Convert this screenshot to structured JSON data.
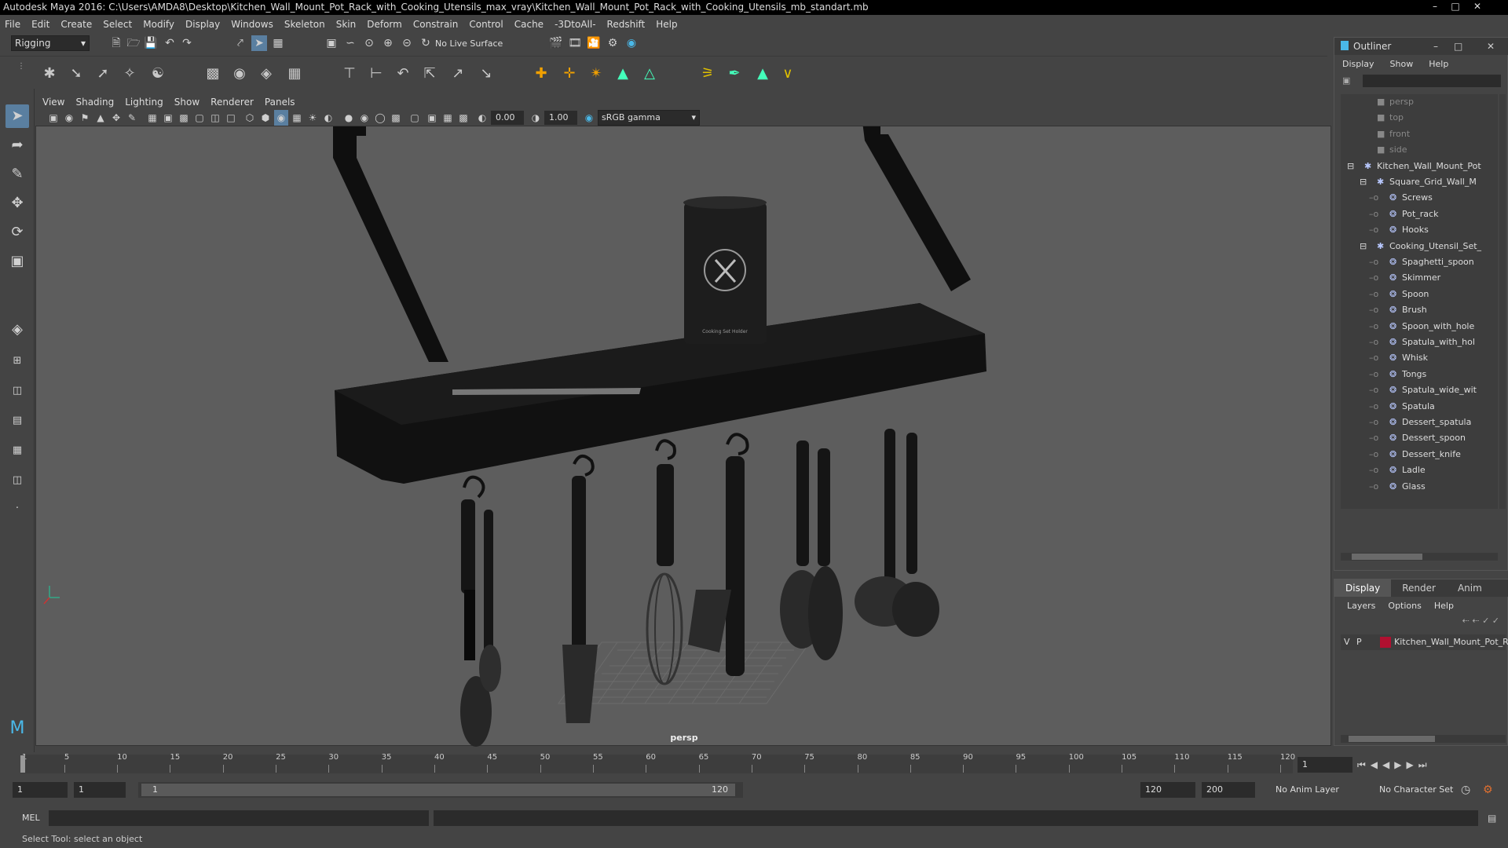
{
  "window": {
    "title": "Autodesk Maya 2016: C:\\Users\\AMDA8\\Desktop\\Kitchen_Wall_Mount_Pot_Rack_with_Cooking_Utensils_max_vray\\Kitchen_Wall_Mount_Pot_Rack_with_Cooking_Utensils_mb_standart.mb"
  },
  "menubar": [
    "File",
    "Edit",
    "Create",
    "Select",
    "Modify",
    "Display",
    "Windows",
    "Skeleton",
    "Skin",
    "Deform",
    "Constrain",
    "Control",
    "Cache",
    "-3DtoAll-",
    "Redshift",
    "Help"
  ],
  "statusline": {
    "mode": "Rigging",
    "live_surface": "No Live Surface"
  },
  "panel": {
    "menus": [
      "View",
      "Shading",
      "Lighting",
      "Show",
      "Renderer",
      "Panels"
    ],
    "exposure": "0.00",
    "gamma": "1.00",
    "colorspace": "sRGB gamma",
    "camera_label": "persp"
  },
  "scene": {
    "can_label": "Cooking Set Holder"
  },
  "outliner": {
    "title": "Outliner",
    "menus": [
      "Display",
      "Show",
      "Help"
    ],
    "items": [
      {
        "label": "persp",
        "level": 1,
        "dim": true
      },
      {
        "label": "top",
        "level": 1,
        "dim": true
      },
      {
        "label": "front",
        "level": 1,
        "dim": true
      },
      {
        "label": "side",
        "level": 1,
        "dim": true
      },
      {
        "label": "Kitchen_Wall_Mount_Pot",
        "level": 0,
        "dim": false
      },
      {
        "label": "Square_Grid_Wall_M",
        "level": 1,
        "dim": false
      },
      {
        "label": "Screws",
        "level": 2,
        "dim": false
      },
      {
        "label": "Pot_rack",
        "level": 2,
        "dim": false
      },
      {
        "label": "Hooks",
        "level": 2,
        "dim": false
      },
      {
        "label": "Cooking_Utensil_Set_",
        "level": 1,
        "dim": false
      },
      {
        "label": "Spaghetti_spoon",
        "level": 2,
        "dim": false
      },
      {
        "label": "Skimmer",
        "level": 2,
        "dim": false
      },
      {
        "label": "Spoon",
        "level": 2,
        "dim": false
      },
      {
        "label": "Brush",
        "level": 2,
        "dim": false
      },
      {
        "label": "Spoon_with_hole",
        "level": 2,
        "dim": false
      },
      {
        "label": "Spatula_with_hol",
        "level": 2,
        "dim": false
      },
      {
        "label": "Whisk",
        "level": 2,
        "dim": false
      },
      {
        "label": "Tongs",
        "level": 2,
        "dim": false
      },
      {
        "label": "Spatula_wide_wit",
        "level": 2,
        "dim": false
      },
      {
        "label": "Spatula",
        "level": 2,
        "dim": false
      },
      {
        "label": "Dessert_spatula",
        "level": 2,
        "dim": false
      },
      {
        "label": "Dessert_spoon",
        "level": 2,
        "dim": false
      },
      {
        "label": "Dessert_knife",
        "level": 2,
        "dim": false
      },
      {
        "label": "Ladle",
        "level": 2,
        "dim": false
      },
      {
        "label": "Glass",
        "level": 2,
        "dim": false
      }
    ]
  },
  "layers": {
    "tabs": [
      "Display",
      "Render",
      "Anim"
    ],
    "menus": [
      "Layers",
      "Options",
      "Help"
    ],
    "layer": {
      "v": "V",
      "p": "P",
      "name": "Kitchen_Wall_Mount_Pot_R",
      "color": "#b01030"
    }
  },
  "timeline": {
    "ticks": [
      "1",
      "5",
      "10",
      "15",
      "20",
      "25",
      "30",
      "35",
      "40",
      "45",
      "50",
      "55",
      "60",
      "65",
      "70",
      "75",
      "80",
      "85",
      "90",
      "95",
      "100",
      "105",
      "110",
      "115",
      "120"
    ],
    "current_frame": "1"
  },
  "range": {
    "start": "1",
    "playback_start": "1",
    "slider_start": "1",
    "slider_end": "120",
    "playback_end": "120",
    "end": "200",
    "anim_layer": "No Anim Layer",
    "char_set": "No Character Set"
  },
  "cmd": {
    "label": "MEL"
  },
  "help": {
    "text": "Select Tool: select an object"
  },
  "colors": {
    "accent": "#4a9fd8",
    "layer": "#b01030"
  }
}
